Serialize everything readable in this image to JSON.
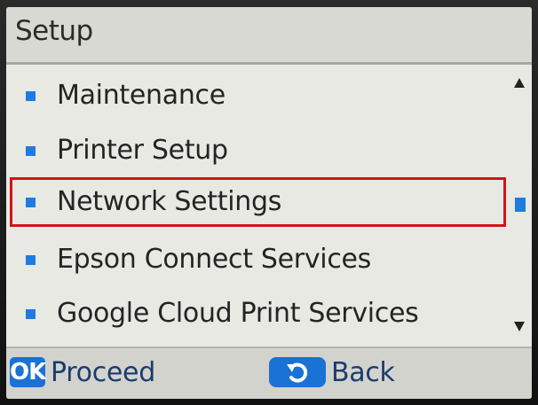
{
  "header": {
    "title": "Setup"
  },
  "menu": {
    "items": [
      {
        "label": "Maintenance"
      },
      {
        "label": "Printer Setup"
      },
      {
        "label": "Network Settings",
        "selected": true
      },
      {
        "label": "Epson Connect Services"
      },
      {
        "label": "Google Cloud Print Services"
      }
    ]
  },
  "footer": {
    "ok_key": "OK",
    "proceed_label": "Proceed",
    "back_label": "Back",
    "back_icon": "back-arrow-icon"
  },
  "colors": {
    "accent": "#1e7be2",
    "highlight_border": "#d2141a",
    "screen_bg": "#e9e9e4"
  }
}
